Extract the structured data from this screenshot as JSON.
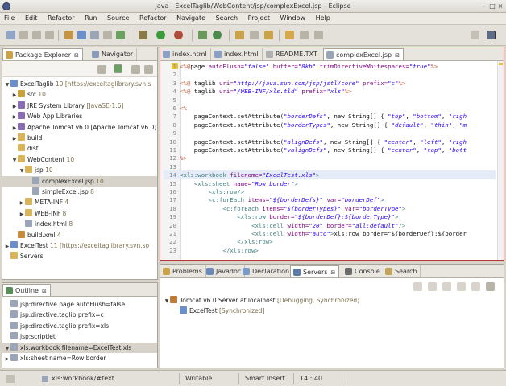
{
  "window": {
    "title": "Java - ExcelTaglib/WebContent/jsp/complexExcel.jsp - Eclipse"
  },
  "menu": [
    "File",
    "Edit",
    "Refactor",
    "Run",
    "Source",
    "Refactor",
    "Navigate",
    "Search",
    "Project",
    "Window",
    "Help"
  ],
  "package_explorer": {
    "tabs": [
      {
        "label": "Package Explorer",
        "close": "⊠"
      },
      {
        "label": "Navigator"
      }
    ],
    "rows": [
      {
        "indent": 0,
        "arrow": "▼",
        "label": "ExcelTaglib",
        "detail": "10 [https://exceltaglibrary.svn.s",
        "icon": "#6b8fc9"
      },
      {
        "indent": 1,
        "arrow": "▶",
        "label": "src",
        "detail": "10",
        "icon": "#c8a038"
      },
      {
        "indent": 1,
        "arrow": "▶",
        "label": "JRE System Library",
        "detail": "[JavaSE-1.6]",
        "icon": "#8a6cb4"
      },
      {
        "indent": 1,
        "arrow": "▶",
        "label": "Web App Libraries",
        "detail": "",
        "icon": "#8a6cb4"
      },
      {
        "indent": 1,
        "arrow": "▶",
        "label": "Apache Tomcat v6.0 [Apache Tomcat v6.0]",
        "detail": "",
        "icon": "#8a6cb4"
      },
      {
        "indent": 1,
        "arrow": "▶",
        "label": "build",
        "detail": "",
        "icon": "#d9b45a"
      },
      {
        "indent": 1,
        "arrow": "",
        "label": "dist",
        "detail": "",
        "icon": "#d9b45a"
      },
      {
        "indent": 1,
        "arrow": "▼",
        "label": "WebContent",
        "detail": "10",
        "icon": "#d9b45a"
      },
      {
        "indent": 2,
        "arrow": "▼",
        "label": "jsp",
        "detail": "10",
        "icon": "#d9b45a"
      },
      {
        "indent": 3,
        "arrow": "",
        "label": "complexExcel.jsp",
        "detail": "10",
        "icon": "#9aa6b8",
        "selected": true
      },
      {
        "indent": 3,
        "arrow": "",
        "label": "simpleExcel.jsp",
        "detail": "8",
        "icon": "#9aa6b8"
      },
      {
        "indent": 2,
        "arrow": "▶",
        "label": "META-INF",
        "detail": "4",
        "icon": "#d9b45a"
      },
      {
        "indent": 2,
        "arrow": "▶",
        "label": "WEB-INF",
        "detail": "8",
        "icon": "#d9b45a"
      },
      {
        "indent": 2,
        "arrow": "",
        "label": "index.html",
        "detail": "8",
        "icon": "#9aa6b8"
      },
      {
        "indent": 1,
        "arrow": "",
        "label": "build.xml",
        "detail": "4",
        "icon": "#c88a38"
      },
      {
        "indent": 0,
        "arrow": "▶",
        "label": "ExcelTest",
        "detail": "11 [https://exceltaglibrary.svn.so",
        "icon": "#6b8fc9"
      },
      {
        "indent": 0,
        "arrow": "",
        "label": "Servers",
        "detail": "",
        "icon": "#d9b45a"
      }
    ]
  },
  "outline": {
    "tab": {
      "label": "Outline",
      "close": "⊠"
    },
    "rows": [
      {
        "arrow": "",
        "label": "jsp:directive.page autoFlush=false"
      },
      {
        "arrow": "",
        "label": "jsp:directive.taglib prefix=c"
      },
      {
        "arrow": "",
        "label": "jsp:directive.taglib prefix=xls"
      },
      {
        "arrow": "",
        "label": "jsp:scriptlet"
      },
      {
        "arrow": "▼",
        "label": "xls:workbook filename=ExcelTest.xls",
        "selected": true
      },
      {
        "arrow": "▶",
        "label": "xls:sheet name=Row border"
      }
    ]
  },
  "editor": {
    "tabs": [
      {
        "label": "index.html"
      },
      {
        "label": "index.html"
      },
      {
        "label": "README.TXT"
      },
      {
        "label": "complexExcel.jsp",
        "close": "⊠",
        "active": true
      }
    ],
    "lines": [
      {
        "n": "1",
        "html": "<span class='tk-pct'>&lt;%@</span>page <span class='tk-attr'>autoFlush=</span><span class='tk-str'>\"false\"</span> <span class='tk-attr'>buffer=</span><span class='tk-str'>\"8kb\"</span> <span class='tk-attr'>trimDirectiveWhitespaces=</span><span class='tk-str'>\"true\"</span><span class='tk-pct'>%&gt;</span>"
      },
      {
        "n": "2",
        "html": ""
      },
      {
        "n": "3",
        "html": "<span class='tk-pct'>&lt;%@</span> taglib <span class='tk-attr'>uri=</span><span class='tk-str'>\"http://java.sun.com/jsp/jstl/core\"</span> <span class='tk-attr'>prefix=</span><span class='tk-str'>\"c\"</span><span class='tk-pct'>%&gt;</span>"
      },
      {
        "n": "4",
        "html": "<span class='tk-pct'>&lt;%@</span> taglib <span class='tk-attr'>uri=</span><span class='tk-str'>\"/WEB-INF/xls.tld\"</span> <span class='tk-attr'>prefix=</span><span class='tk-str'>\"xls\"</span><span class='tk-pct'>%&gt;</span>"
      },
      {
        "n": "5",
        "html": ""
      },
      {
        "n": "6",
        "html": "<span class='tk-pct'>&lt;%</span>"
      },
      {
        "n": "7",
        "html": "    pageContext.setAttribute(<span class='tk-str'>\"borderDefs\"</span>, new String[] { <span class='tk-str'>\"top\"</span>, <span class='tk-str'>\"bottom\"</span>, <span class='tk-str'>\"righ</span>"
      },
      {
        "n": "8",
        "html": "    pageContext.setAttribute(<span class='tk-str'>\"borderTypes\"</span>, new String[] { <span class='tk-str'>\"default\"</span>, <span class='tk-str'>\"thin\"</span>, <span class='tk-str'>\"m</span>"
      },
      {
        "n": "9",
        "html": ""
      },
      {
        "n": "10",
        "html": "    pageContext.setAttribute(<span class='tk-str'>\"alignDefs\"</span>, new String[] { <span class='tk-str'>\"center\"</span>, <span class='tk-str'>\"left\"</span>, <span class='tk-str'>\"righ</span>"
      },
      {
        "n": "11",
        "html": "    pageContext.setAttribute(<span class='tk-str'>\"valignDefs\"</span>, new String[] { <span class='tk-str'>\"center\"</span>, <span class='tk-str'>\"top\"</span>, <span class='tk-str'>\"bott</span>"
      },
      {
        "n": "12",
        "html": "<span class='tk-pct'>%&gt;</span>"
      },
      {
        "n": "13",
        "html": ""
      },
      {
        "n": "14",
        "html": "<span class='tk-tag'>&lt;xls:workbook</span> <span class='tk-attr'>filename=</span><span class='tk-str'>\"ExcelTest.xls\"</span><span class='tk-tag'>&gt;</span>",
        "current": true
      },
      {
        "n": "15",
        "html": "    <span class='tk-tag'>&lt;xls:sheet</span> <span class='tk-attr'>name=</span><span class='tk-str'>\"Row border\"</span><span class='tk-tag'>&gt;</span>"
      },
      {
        "n": "16",
        "html": "        <span class='tk-tag'>&lt;xls:row/&gt;</span>"
      },
      {
        "n": "17",
        "html": "        <span class='tk-tag'>&lt;c:forEach</span> <span class='tk-attr'>items=</span><span class='tk-str'>\"${borderDefs}\"</span> <span class='tk-attr'>var=</span><span class='tk-str'>\"borderDef\"</span><span class='tk-tag'>&gt;</span>"
      },
      {
        "n": "18",
        "html": "            <span class='tk-tag'>&lt;c:forEach</span> <span class='tk-attr'>items=</span><span class='tk-str'>\"${borderTypes}\"</span> <span class='tk-attr'>var=</span><span class='tk-str'>\"borderType\"</span><span class='tk-tag'>&gt;</span>"
      },
      {
        "n": "19",
        "html": "                <span class='tk-tag'>&lt;xls:row</span> <span class='tk-attr'>border=</span><span class='tk-str'>\"${borderDef}:${borderType}\"</span><span class='tk-tag'>&gt;</span>"
      },
      {
        "n": "20",
        "html": "                    <span class='tk-tag'>&lt;xls:cell</span> <span class='tk-attr'>width=</span><span class='tk-str'>\"20\"</span> <span class='tk-attr'>border=</span><span class='tk-str'>\"all:default\"</span><span class='tk-tag'>/&gt;</span>"
      },
      {
        "n": "21",
        "html": "                    <span class='tk-tag'>&lt;xls:cell</span> <span class='tk-attr'>width=</span><span class='tk-str'>\"auto\"</span><span class='tk-tag'>&gt;</span>xls:row border=\"${borderDef}:${border</span>"
      },
      {
        "n": "22",
        "html": "                <span class='tk-tag'>&lt;/xls:row&gt;</span>"
      },
      {
        "n": "23",
        "html": "            <span class='tk-tag'>&lt;/xls:row&gt;</span>"
      }
    ]
  },
  "bottom_panel": {
    "tabs": [
      {
        "label": "Problems"
      },
      {
        "label": "Javadoc"
      },
      {
        "label": "Declaration"
      },
      {
        "label": "Servers",
        "close": "⊠",
        "active": true
      },
      {
        "label": "Console"
      },
      {
        "label": "Search"
      }
    ],
    "servers": [
      {
        "arrow": "▼",
        "label": "Tomcat v6.0 Server at localhost",
        "status": "[Debugging, Synchronized]"
      },
      {
        "arrow": "",
        "label": "ExcelTest",
        "status": "[Synchronized]"
      }
    ]
  },
  "status": {
    "path": "xls:workbook/#text",
    "mode": "Writable",
    "insert": "Smart Insert",
    "position": "14 : 40"
  },
  "colors": {
    "accent": "#b73a3a",
    "selection": "#c7d4e9"
  }
}
